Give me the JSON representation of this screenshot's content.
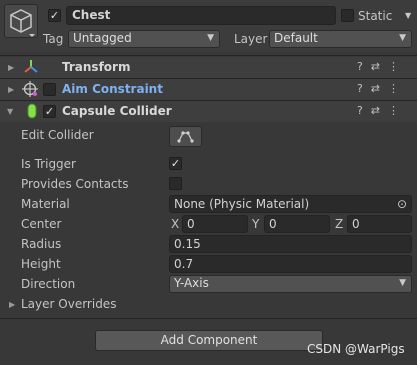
{
  "gameobject": {
    "enabled": true,
    "name": "Chest",
    "static_label": "Static",
    "static_checked": false,
    "tag_label": "Tag",
    "tag_value": "Untagged",
    "layer_label": "Layer",
    "layer_value": "Default"
  },
  "components": [
    {
      "name": "Transform",
      "icon": "transform-icon"
    },
    {
      "name": "Aim Constraint",
      "icon": "aim-constraint-icon",
      "enabled": false
    },
    {
      "name": "Capsule Collider",
      "icon": "capsule-collider-icon",
      "enabled": true
    }
  ],
  "collider": {
    "edit_collider_label": "Edit Collider",
    "is_trigger_label": "Is Trigger",
    "is_trigger": true,
    "provides_contacts_label": "Provides Contacts",
    "provides_contacts": false,
    "material_label": "Material",
    "material_value": "None (Physic Material)",
    "center_label": "Center",
    "center": {
      "x_label": "X",
      "x": "0",
      "y_label": "Y",
      "y": "0",
      "z_label": "Z",
      "z": "0"
    },
    "radius_label": "Radius",
    "radius": "0.15",
    "height_label": "Height",
    "height": "0.7",
    "direction_label": "Direction",
    "direction": "Y-Axis",
    "layer_overrides_label": "Layer Overrides"
  },
  "add_component_label": "Add Component",
  "watermark": "CSDN @WarPigs",
  "colors": {
    "background": "#383838",
    "field": "#2a2a2a",
    "link_blue": "#7fb1f0",
    "capsule_green": "#86e04a"
  },
  "glyphs": {
    "check": "✓",
    "chevron_down": "▼",
    "foldout_right": "▶",
    "foldout_down": "▼",
    "help": "?",
    "settings": "⇄",
    "more": "⋮",
    "picker": "⊙"
  }
}
